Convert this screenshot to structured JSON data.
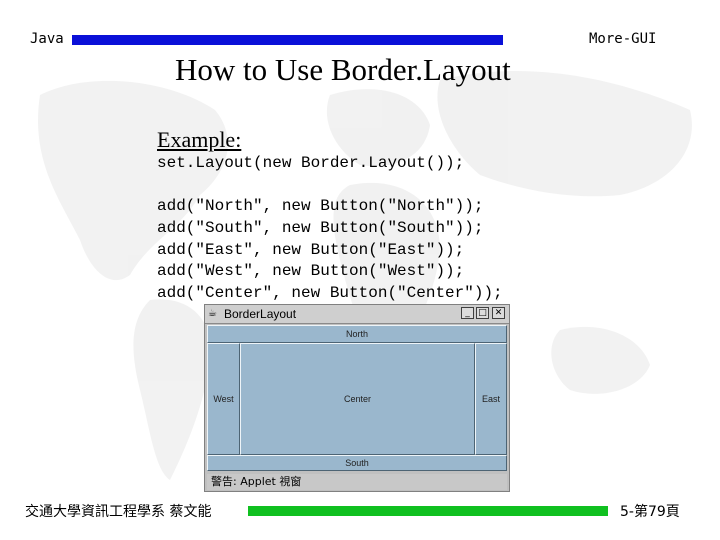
{
  "header": {
    "left_label": "Java",
    "right_label": "More-GUI",
    "bar_color": "#0a10d8"
  },
  "slide": {
    "title": "How to Use Border.Layout",
    "example_label": "Example:",
    "code_lines": [
      "set.Layout(new Border.Layout());",
      "",
      "add(\"North\", new Button(\"North\"));",
      "add(\"South\", new Button(\"South\"));",
      "add(\"East\", new Button(\"East\"));",
      "add(\"West\", new Button(\"West\"));",
      "add(\"Center\", new Button(\"Center\"));"
    ]
  },
  "applet": {
    "icon": "java-cup-icon",
    "title": "BorderLayout",
    "buttons": {
      "north": "North",
      "south": "South",
      "east": "East",
      "west": "West",
      "center": "Center"
    },
    "status": "警告: Applet 視窗",
    "body_color": "#9ab7cd"
  },
  "footer": {
    "left_label": "交通大學資訊工程學系 蔡文能",
    "right_label": "5-第79頁",
    "bar_color": "#10c020"
  }
}
